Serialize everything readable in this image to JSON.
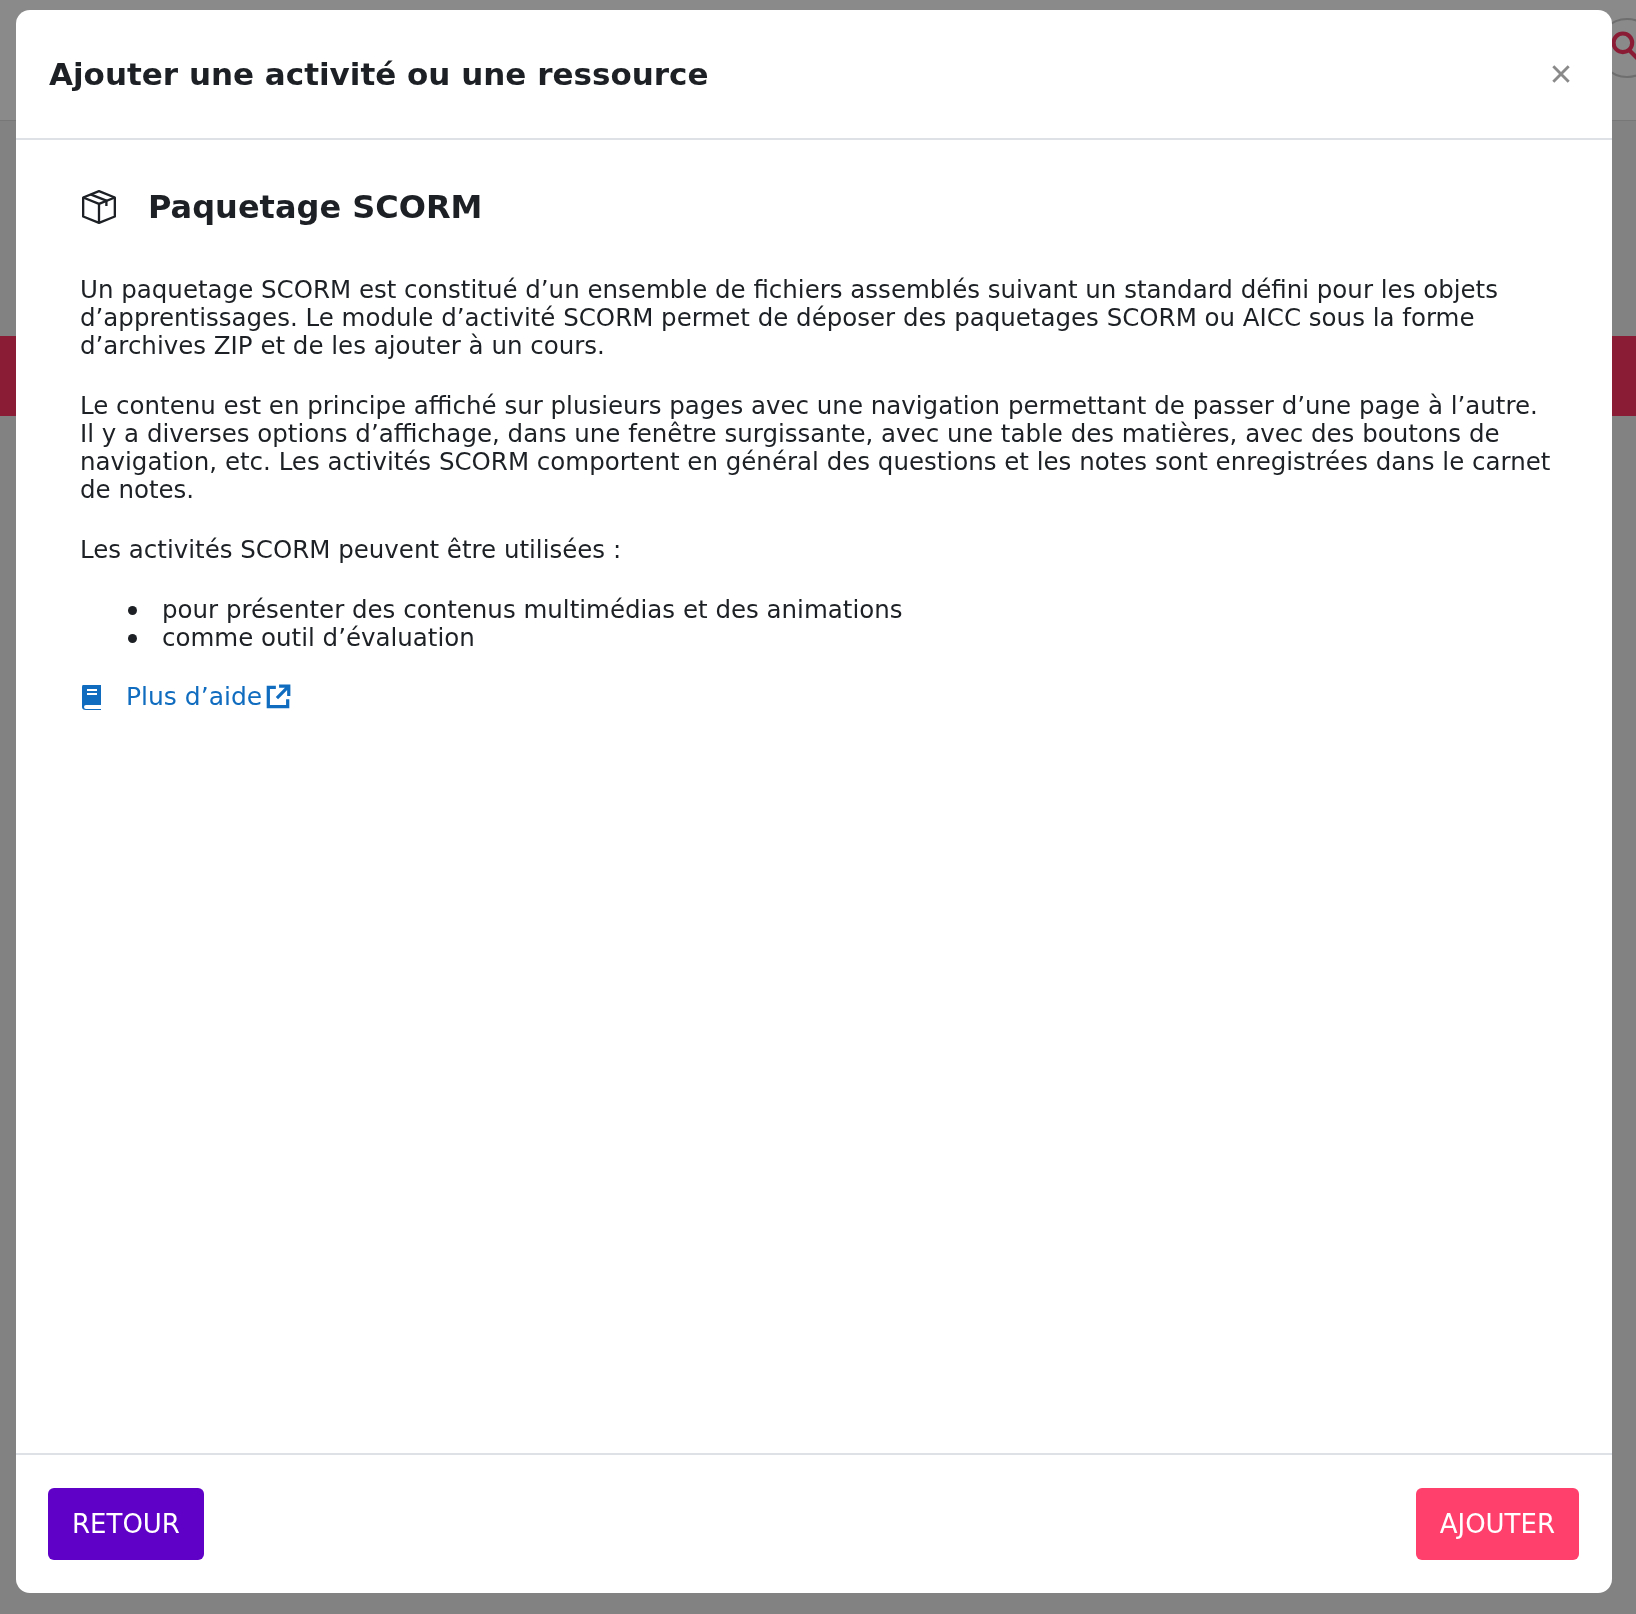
{
  "dialog": {
    "title": "Ajouter une activité ou une ressource",
    "module": {
      "name": "Paquetage SCORM",
      "paragraphs": [
        "Un paquetage SCORM est constitué d’un ensemble de fichiers assemblés suivant un standard défini pour les objets d’apprentissages. Le module d’activité SCORM permet de déposer des paquetages SCORM ou AICC sous la forme d’archives ZIP et de les ajouter à un cours.",
        "Le contenu est en principe affiché sur plusieurs pages avec une navigation permettant de passer d’une page à l’autre. Il y a diverses options d’affichage, dans une fenêtre surgissante, avec une table des matières, avec des boutons de navigation, etc. Les activités SCORM comportent en général des questions et les notes sont enregistrées dans le carnet de notes.",
        "Les activités SCORM peuvent être utilisées :"
      ],
      "bullets": [
        "pour présenter des contenus multimédias et des animations",
        "comme outil d’évaluation"
      ],
      "help_link": "Plus d’aide"
    },
    "buttons": [
      {
        "label": "RETOUR",
        "kind": "back"
      },
      {
        "label": "AJOUTER",
        "kind": "primary"
      }
    ]
  }
}
